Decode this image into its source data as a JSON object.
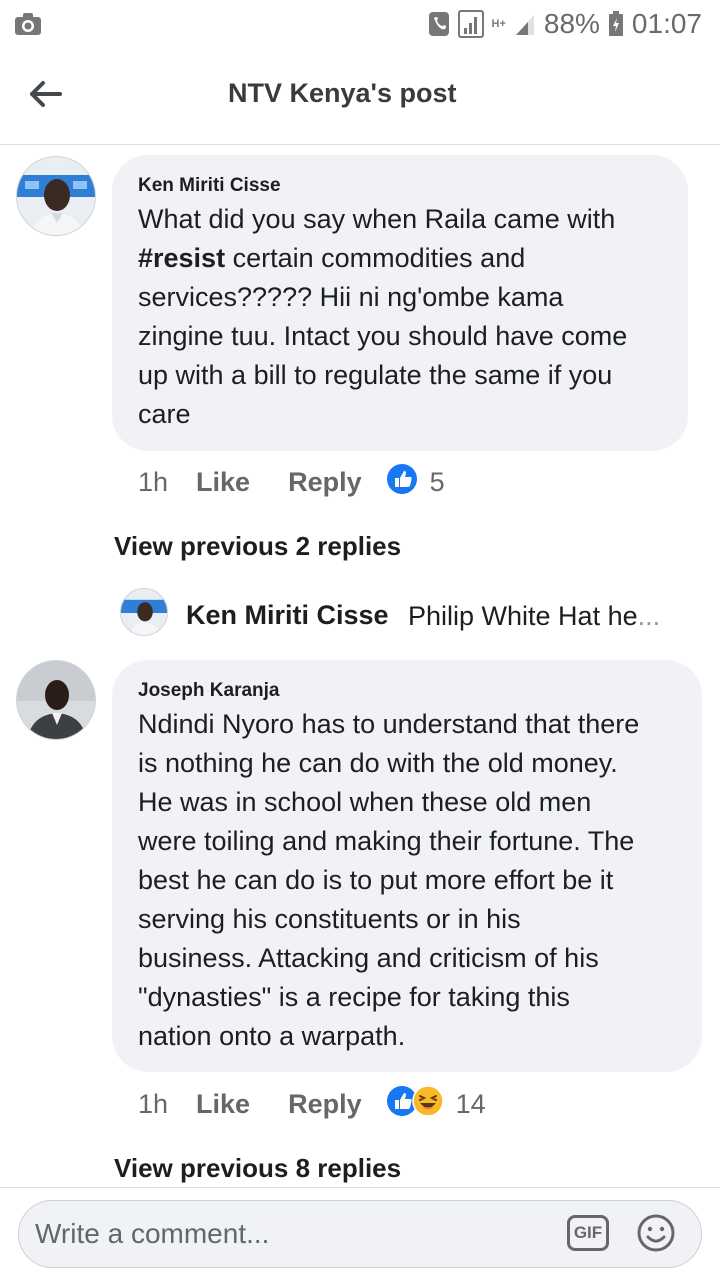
{
  "status_bar": {
    "battery": "88%",
    "time": "01:07",
    "network": "H+",
    "icons": [
      "camera-icon",
      "vibrate-icon",
      "signal-icon",
      "network-icon",
      "battery-icon"
    ]
  },
  "header": {
    "title": "NTV Kenya's post",
    "back_icon": "back-arrow-icon"
  },
  "comments": [
    {
      "author": "Ken Miriti Cisse",
      "text_lines": [
        "What did you say when Raila came with",
        "certain commodities and",
        "services????? Hii ni ng'ombe kama",
        "zingine tuu. Intact you should have come",
        "up with a bill to regulate the same if you",
        "care"
      ],
      "hashtag": "#resist",
      "time": "1h",
      "like_label": "Like",
      "reply_label": "Reply",
      "reaction_count": "5",
      "view_previous": "View previous 2 replies",
      "reply_preview": {
        "author": "Ken Miriti Cisse",
        "text": "Philip White Hat he",
        "ellipsis": "..."
      }
    },
    {
      "author": "Joseph Karanja",
      "text_lines": [
        "Ndindi Nyoro has to understand that there",
        "is nothing he can do with the old money.",
        "He was in school when these old men",
        "were toiling and making their fortune. The",
        "best he can do is to put more effort be it",
        "serving his constituents or in his",
        "business. Attacking and criticism of his",
        "\"dynasties\" is a recipe for taking this",
        "nation onto a warpath."
      ],
      "time": "1h",
      "like_label": "Like",
      "reply_label": "Reply",
      "reaction_count": "14",
      "view_previous": "View previous 8 replies"
    }
  ],
  "composer": {
    "placeholder": "Write a comment...",
    "gif_label": "GIF"
  },
  "colors": {
    "facebook_blue": "#1877f2",
    "bubble_bg": "#f0f2f5",
    "secondary_text": "#65676b",
    "haha_yellow": "#f7b928"
  }
}
